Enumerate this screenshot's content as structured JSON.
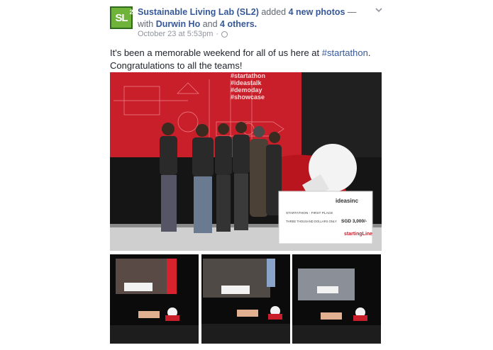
{
  "post": {
    "page_name": "Sustainable Living Lab (SL2)",
    "action_text": " added ",
    "photos_link": "4 new photos",
    "with_text": " — with",
    "tagged_user": "Durwin Ho",
    "and_text": " and ",
    "others_link": "4 others.",
    "timestamp": "October 23 at 5:53pm",
    "separator": "·",
    "caption_pre": "It's been a memorable weekend for all of us here at ",
    "caption_hashtag": "#startathon",
    "caption_post": ".",
    "caption_line2": "Congratulations to all the teams!"
  },
  "avatar": {
    "text": "SL",
    "superscript": "2"
  },
  "main_photo": {
    "banner_lines": [
      "#startathon",
      "#ideastalk",
      "#demoday",
      "#showcase"
    ],
    "cheque_brand": "ideasinc",
    "cheque_title": "STARTATHON - FIRST PLACE",
    "cheque_amount": "SGD 3,000/-",
    "cheque_words": "THREE THOUSAND DOLLARS ONLY",
    "cheque_footer": "startingLine"
  },
  "colors": {
    "link": "#365899",
    "avatar_bg": "#6fb33a",
    "stage_red": "#d8232e"
  },
  "icons": {
    "globe": "globe-icon",
    "chevron": "chevron-down-icon"
  }
}
